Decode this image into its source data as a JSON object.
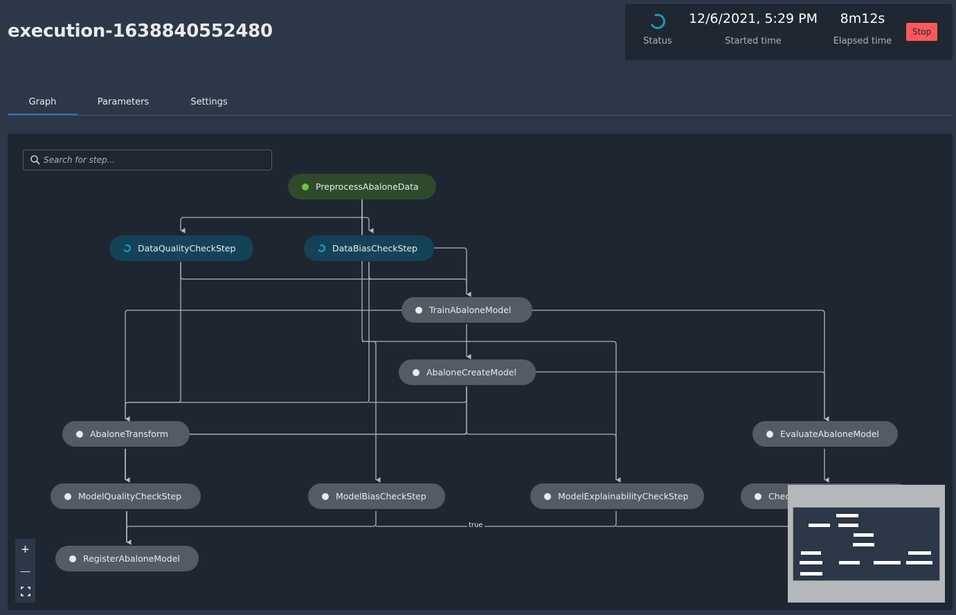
{
  "header": {
    "title": "execution-1638840552480"
  },
  "status_panel": {
    "status_label": "Status",
    "status_icon": "spinner-icon",
    "started_time_value": "12/6/2021, 5:29 PM",
    "started_time_label": "Started time",
    "elapsed_time_value": "8m12s",
    "elapsed_time_label": "Elapsed time",
    "stop_label": "Stop"
  },
  "tabs": [
    {
      "label": "Graph",
      "active": true
    },
    {
      "label": "Parameters",
      "active": false
    },
    {
      "label": "Settings",
      "active": false
    }
  ],
  "graph": {
    "search_placeholder": "Search for step...",
    "nodes": [
      {
        "id": "preprocess",
        "label": "PreprocessAbaloneData",
        "status": "succeeded"
      },
      {
        "id": "dataquality",
        "label": "DataQualityCheckStep",
        "status": "executing"
      },
      {
        "id": "databias",
        "label": "DataBiasCheckStep",
        "status": "executing"
      },
      {
        "id": "train",
        "label": "TrainAbaloneModel",
        "status": "not-started"
      },
      {
        "id": "createmodel",
        "label": "AbaloneCreateModel",
        "status": "not-started"
      },
      {
        "id": "transform",
        "label": "AbaloneTransform",
        "status": "not-started"
      },
      {
        "id": "evaluate",
        "label": "EvaluateAbaloneModel",
        "status": "not-started"
      },
      {
        "id": "modelquality",
        "label": "ModelQualityCheckStep",
        "status": "not-started"
      },
      {
        "id": "modelbias",
        "label": "ModelBiasCheckStep",
        "status": "not-started"
      },
      {
        "id": "modelexplain",
        "label": "ModelExplainabilityCheckStep",
        "status": "not-started"
      },
      {
        "id": "check",
        "label": "Check",
        "status": "not-started"
      },
      {
        "id": "register",
        "label": "RegisterAbaloneModel",
        "status": "not-started"
      }
    ],
    "edge_label": "true",
    "colors": {
      "succeeded": "#2f4a2b",
      "executing": "#144257",
      "not_started": "#545b64",
      "success_dot": "#6ac43a",
      "spinner": "#1fa3d6",
      "stop": "#ff5a5a"
    }
  },
  "controls": {
    "zoom_in": "+",
    "zoom_out": "—",
    "fit": "⛶"
  }
}
